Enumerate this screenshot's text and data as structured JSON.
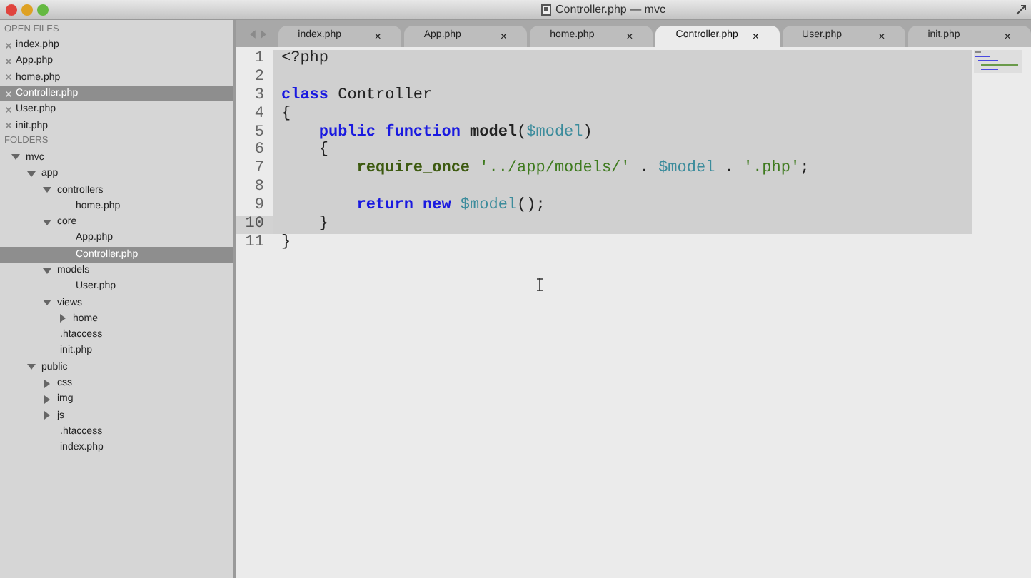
{
  "window": {
    "title": "Controller.php — mvc"
  },
  "sidebar": {
    "open_files_heading": "OPEN FILES",
    "open_files": [
      {
        "name": "index.php",
        "selected": false
      },
      {
        "name": "App.php",
        "selected": false
      },
      {
        "name": "home.php",
        "selected": false
      },
      {
        "name": "Controller.php",
        "selected": true
      },
      {
        "name": "User.php",
        "selected": false
      },
      {
        "name": "init.php",
        "selected": false
      }
    ],
    "folders_heading": "FOLDERS",
    "tree": [
      {
        "name": "mvc",
        "kind": "folder",
        "expanded": true,
        "selected": false,
        "children": [
          {
            "name": "app",
            "kind": "folder",
            "expanded": true,
            "selected": false,
            "children": [
              {
                "name": "controllers",
                "kind": "folder",
                "expanded": true,
                "selected": false,
                "children": [
                  {
                    "name": "home.php",
                    "kind": "file",
                    "selected": false
                  }
                ]
              },
              {
                "name": "core",
                "kind": "folder",
                "expanded": true,
                "selected": false,
                "children": [
                  {
                    "name": "App.php",
                    "kind": "file",
                    "selected": false
                  },
                  {
                    "name": "Controller.php",
                    "kind": "file",
                    "selected": true
                  }
                ]
              },
              {
                "name": "models",
                "kind": "folder",
                "expanded": true,
                "selected": false,
                "children": [
                  {
                    "name": "User.php",
                    "kind": "file",
                    "selected": false
                  }
                ]
              },
              {
                "name": "views",
                "kind": "folder",
                "expanded": true,
                "selected": false,
                "children": [
                  {
                    "name": "home",
                    "kind": "folder",
                    "expanded": false,
                    "selected": false
                  }
                ]
              },
              {
                "name": ".htaccess",
                "kind": "file",
                "selected": false
              },
              {
                "name": "init.php",
                "kind": "file",
                "selected": false
              }
            ]
          },
          {
            "name": "public",
            "kind": "folder",
            "expanded": true,
            "selected": false,
            "children": [
              {
                "name": "css",
                "kind": "folder",
                "expanded": false,
                "selected": false
              },
              {
                "name": "img",
                "kind": "folder",
                "expanded": false,
                "selected": false
              },
              {
                "name": "js",
                "kind": "folder",
                "expanded": false,
                "selected": false
              },
              {
                "name": ".htaccess",
                "kind": "file",
                "selected": false
              },
              {
                "name": "index.php",
                "kind": "file",
                "selected": false
              }
            ]
          }
        ]
      }
    ]
  },
  "tabs": [
    {
      "label": "index.php",
      "close": "×",
      "selected": false
    },
    {
      "label": "App.php",
      "close": "×",
      "selected": false
    },
    {
      "label": "home.php",
      "close": "×",
      "selected": false
    },
    {
      "label": "Controller.php",
      "close": "×",
      "selected": true
    },
    {
      "label": "User.php",
      "close": "×",
      "selected": false
    },
    {
      "label": "init.php",
      "close": "×",
      "selected": false
    }
  ],
  "editor": {
    "lines": [
      {
        "number": "1",
        "selected": true,
        "current": false,
        "tokens": [
          {
            "kind": "plain",
            "text": "<?php"
          }
        ]
      },
      {
        "number": "2",
        "selected": true,
        "current": false
      },
      {
        "number": "3",
        "selected": true,
        "current": false,
        "tokens": [
          {
            "kind": "keyword",
            "text": "class"
          },
          {
            "kind": "plain",
            "text": " Controller"
          }
        ]
      },
      {
        "number": "4",
        "selected": true,
        "current": false,
        "tokens": [
          {
            "kind": "plain",
            "text": "{"
          }
        ]
      },
      {
        "number": "5",
        "selected": true,
        "current": false,
        "tokens": [
          {
            "kind": "keyword",
            "text": "    public function"
          },
          {
            "kind": "function",
            "text": " model"
          },
          {
            "kind": "plain",
            "text": "("
          },
          {
            "kind": "variable",
            "text": "$model"
          },
          {
            "kind": "plain",
            "text": ")"
          }
        ]
      },
      {
        "number": "6",
        "selected": true,
        "current": false,
        "tokens": [
          {
            "kind": "plain",
            "text": "    {"
          }
        ]
      },
      {
        "number": "7",
        "selected": true,
        "current": false,
        "tokens": [
          {
            "kind": "builtin",
            "text": "        require_once"
          },
          {
            "kind": "string",
            "text": " '../app/models/'"
          },
          {
            "kind": "plain",
            "text": " . "
          },
          {
            "kind": "variable",
            "text": "$model"
          },
          {
            "kind": "plain",
            "text": " . "
          },
          {
            "kind": "string",
            "text": "'.php'"
          },
          {
            "kind": "plain",
            "text": ";"
          }
        ]
      },
      {
        "number": "8",
        "selected": true,
        "current": false
      },
      {
        "number": "9",
        "selected": true,
        "current": false,
        "tokens": [
          {
            "kind": "keyword",
            "text": "        return new"
          },
          {
            "kind": "variable",
            "text": " $model"
          },
          {
            "kind": "plain",
            "text": "();"
          }
        ]
      },
      {
        "number": "10",
        "selected": true,
        "current": true,
        "tokens": [
          {
            "kind": "plain",
            "text": "    }"
          }
        ]
      },
      {
        "number": "11",
        "selected": false,
        "current": false,
        "tokens": [
          {
            "kind": "plain",
            "text": "}"
          }
        ]
      }
    ]
  }
}
